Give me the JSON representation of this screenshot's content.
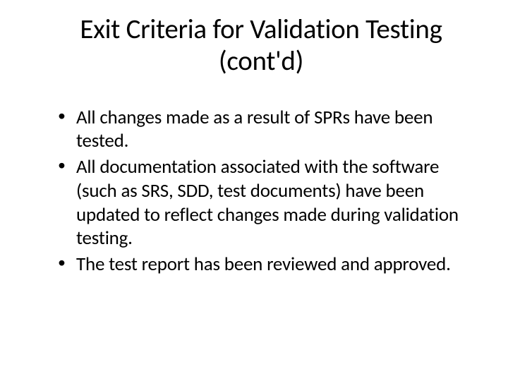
{
  "slide": {
    "title": "Exit Criteria for Validation Testing (cont'd)",
    "bullets": [
      "All changes made as a result of SPRs have been tested.",
      "All documentation associated with the software (such as SRS, SDD, test documents) have been updated to reflect changes made during validation testing.",
      "The test report has been reviewed and approved."
    ]
  }
}
